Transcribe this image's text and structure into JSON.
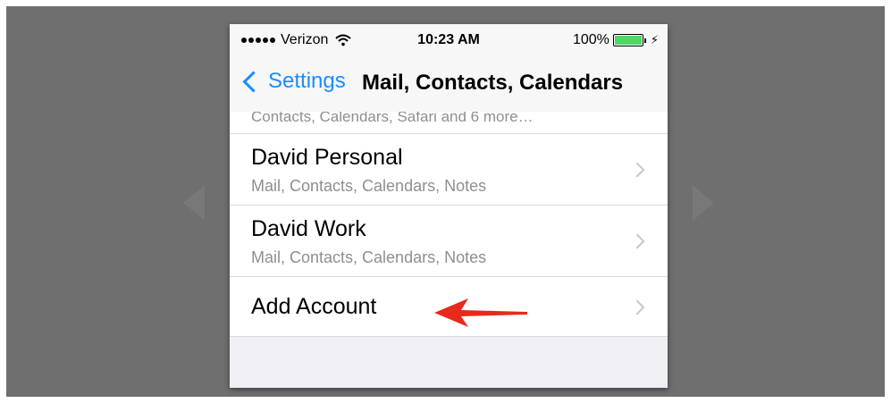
{
  "status_bar": {
    "carrier": "Verizon",
    "time": "10:23 AM",
    "battery": "100%"
  },
  "nav": {
    "back_label": "Settings",
    "title": "Mail, Contacts, Calendars"
  },
  "accounts": {
    "cut_row_text": "Contacts, Calendars, Safari and 6 more…",
    "items": [
      {
        "title": "David Personal",
        "subtitle": "Mail, Contacts, Calendars, Notes"
      },
      {
        "title": "David Work",
        "subtitle": "Mail, Contacts, Calendars, Notes"
      }
    ],
    "add_label": "Add Account"
  },
  "colors": {
    "accent": "#1a8cff",
    "battery": "#4cd964",
    "annotation_arrow": "#e8291c",
    "backdrop": "#6f6f6f"
  },
  "icons": [
    "wifi-icon",
    "battery-icon",
    "bolt-icon",
    "back-chevron-icon",
    "chevron-right-icon",
    "red-arrow-icon"
  ]
}
